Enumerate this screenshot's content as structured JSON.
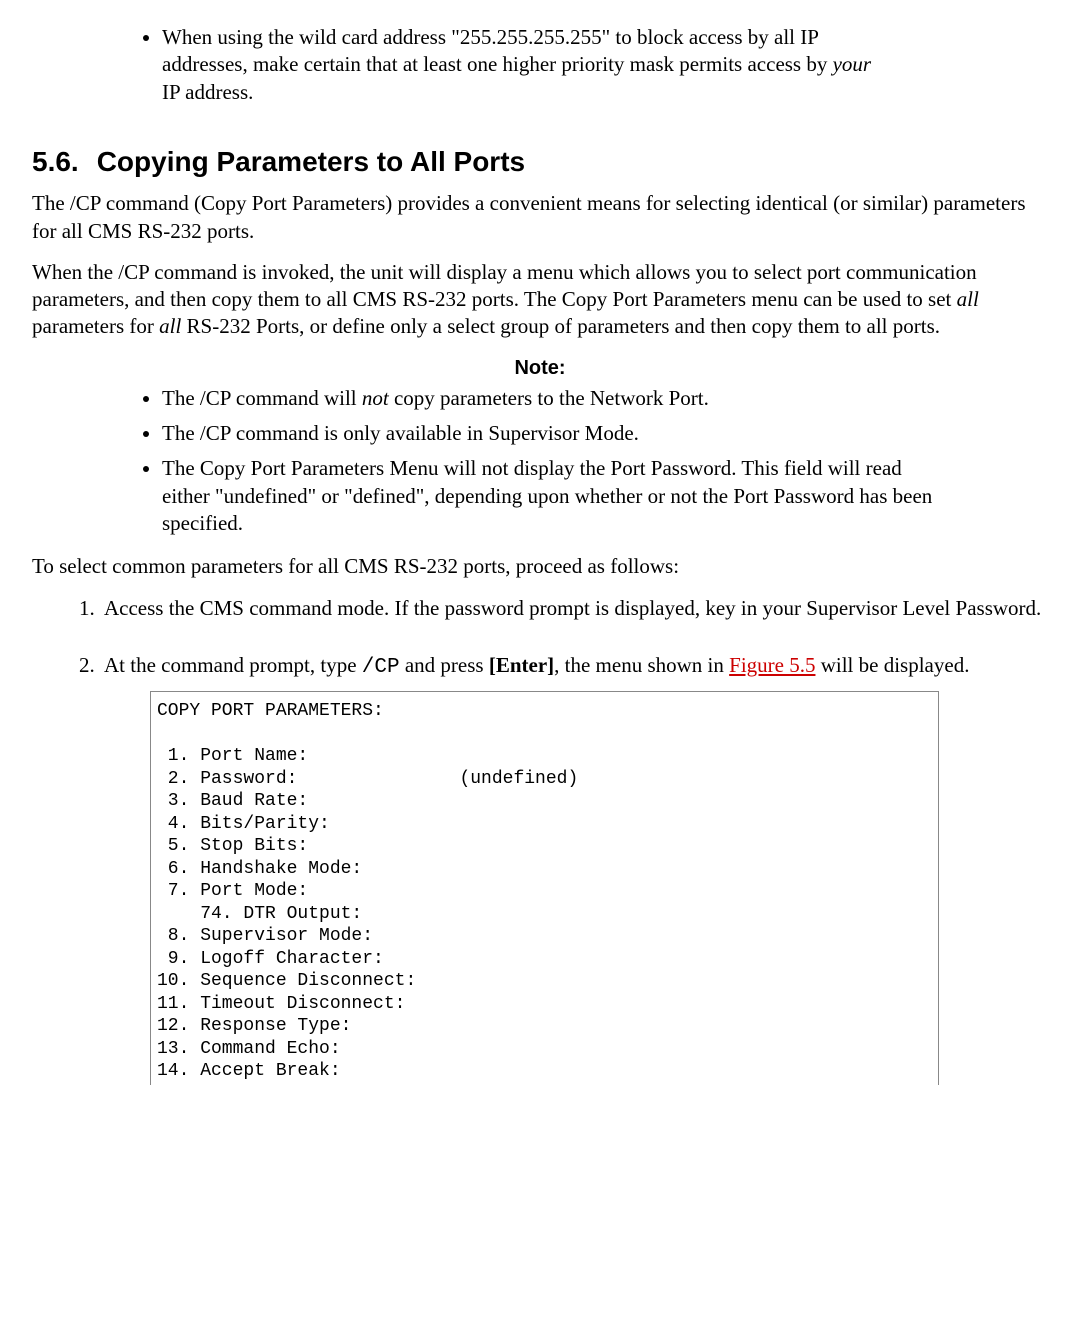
{
  "top_bullet": {
    "pre": "When using the wild card address \"255.255.255.255\" to block access by all IP addresses, make certain that at least one higher priority mask permits access by ",
    "ital": "your",
    "post": " IP address."
  },
  "section": {
    "num": "5.6.",
    "title": "Copying Parameters to All Ports"
  },
  "para1": "The /CP command (Copy Port Parameters) provides a convenient means for selecting identical (or similar) parameters for all CMS RS-232 ports.",
  "para2": {
    "a": "When the /CP command is invoked, the unit will display a menu which allows you to select port communication parameters, and then copy them to all CMS RS-232 ports. The Copy Port Parameters menu can be used to set ",
    "i1": "all",
    "b": " parameters for ",
    "i2": "all",
    "c": " RS-232 Ports, or define only a select group of parameters and then copy them to all ports."
  },
  "note_label": "Note:",
  "notes": {
    "n1a": "The /CP command will ",
    "n1i": "not",
    "n1b": " copy parameters to the Network Port.",
    "n2": "The /CP command is only available in Supervisor Mode.",
    "n3": "The Copy Port Parameters Menu will not display the Port Password. This field will read either \"undefined\" or \"defined\", depending upon whether or not the Port Password has been specified."
  },
  "para3": "To select common parameters for all CMS RS-232 ports, proceed as follows:",
  "steps": {
    "s1": "Access the CMS command mode. If the password prompt is displayed, key in your Supervisor Level Password.",
    "s2a": "At the command prompt, type ",
    "s2code": "/CP",
    "s2b": " and press ",
    "s2enter": "[Enter]",
    "s2c": ", the menu shown in ",
    "s2link": "Figure 5.5",
    "s2d": " will be displayed."
  },
  "terminal": "COPY PORT PARAMETERS:\n\n 1. Port Name:\n 2. Password:               (undefined)\n 3. Baud Rate:\n 4. Bits/Parity:\n 5. Stop Bits:\n 6. Handshake Mode:\n 7. Port Mode:\n    74. DTR Output:\n 8. Supervisor Mode:\n 9. Logoff Character:\n10. Sequence Disconnect:\n11. Timeout Disconnect:\n12. Response Type:\n13. Command Echo:\n14. Accept Break:\n"
}
